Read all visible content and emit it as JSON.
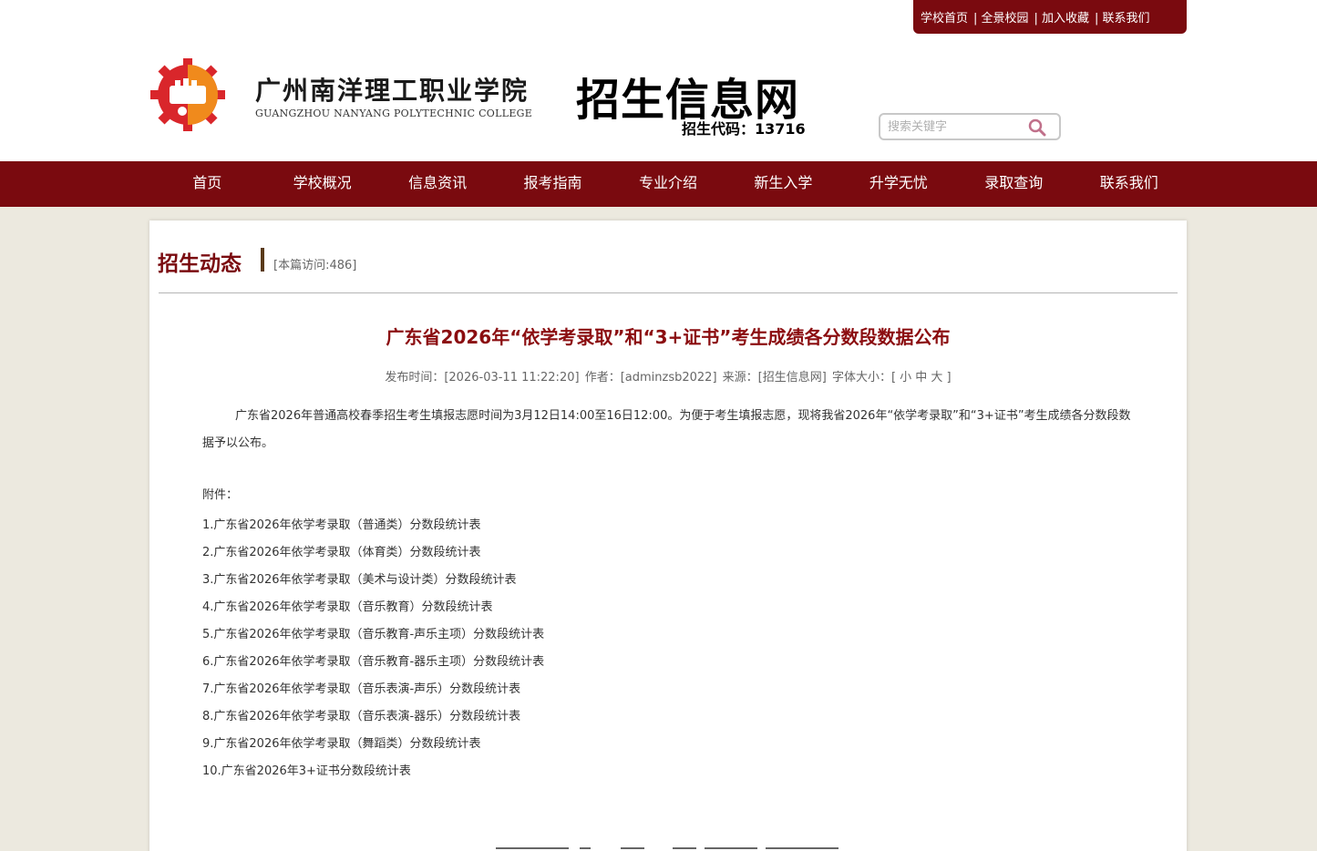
{
  "top_links": [
    "学校首页",
    "| 全景校园",
    "| 加入收藏",
    "| 联系我们"
  ],
  "logo": {
    "name_cn": "广州南洋理工职业学院",
    "name_en": "GUANGZHOU NANYANG POLYTECHNIC COLLEGE"
  },
  "site": {
    "title": "招生信息网",
    "code_line": "招生代码：13716"
  },
  "search": {
    "placeholder": "搜索关键字"
  },
  "nav": [
    "首页",
    "学校概况",
    "信息资讯",
    "报考指南",
    "专业介绍",
    "新生入学",
    "升学无忧",
    "录取查询",
    "联系我们"
  ],
  "section": {
    "title": "招生动态",
    "visits": "[本篇访问:486]"
  },
  "article": {
    "title": "广东省2026年“依学考录取”和“3+证书”考生成绩各分数段数据公布",
    "meta": {
      "time": "发布时间：[2026-03-11 11:22:20]",
      "author": "作者：[adminzsb2022]",
      "source": "来源：[招生信息网]",
      "font_size_label": "字体大小：[ 小 中 大 ]"
    },
    "body": "广东省2026年普通高校春季招生考生填报志愿时间为3月12日14:00至16日12:00。为便于考生填报志愿，现将我省2026年“依学考录取”和“3+证书”考生成绩各分数段数据予以公布。",
    "attachments_label": "附件：",
    "attachments": [
      "1.广东省2026年依学考录取（普通类）分数段统计表",
      "2.广东省2026年依学考录取（体育类）分数段统计表",
      "3.广东省2026年依学考录取（美术与设计类）分数段统计表",
      "4.广东省2026年依学考录取（音乐教育）分数段统计表",
      "5.广东省2026年依学考录取（音乐教育-声乐主项）分数段统计表",
      "6.广东省2026年依学考录取（音乐教育-器乐主项）分数段统计表",
      "7.广东省2026年依学考录取（音乐表演-声乐）分数段统计表",
      "8.广东省2026年依学考录取（音乐表演-器乐）分数段统计表",
      "9.广东省2026年依学考录取（舞蹈类）分数段统计表",
      "10.广东省2026年3+证书分数段统计表"
    ]
  },
  "colors": {
    "brand": "#7a0a0f",
    "title_red": "#8b0d10",
    "page_bg": "#ece9df",
    "logo_red": "#d9262b",
    "logo_orange": "#f08a1c"
  },
  "icons": [
    "school-logo-icon",
    "search-icon"
  ]
}
